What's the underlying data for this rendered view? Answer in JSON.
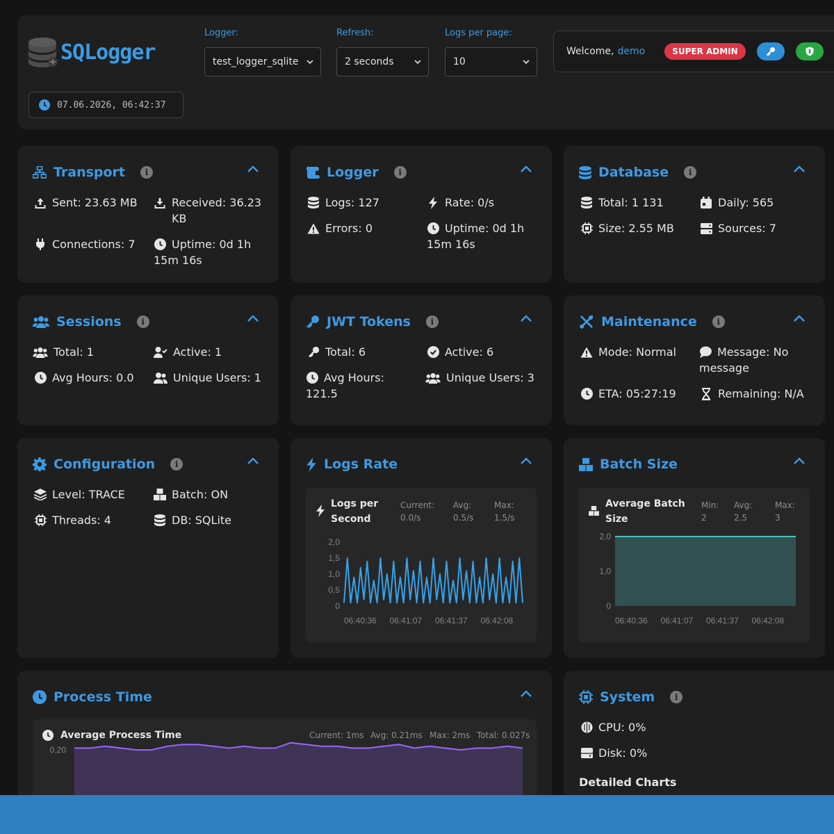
{
  "app": {
    "title": "SQLogger",
    "datetime": "07.06.2026, 06:42:37"
  },
  "controls": {
    "logger": {
      "label": "Logger:",
      "value": "test_logger_sqlite"
    },
    "refresh": {
      "label": "Refresh:",
      "value": "2 seconds"
    },
    "per_page": {
      "label": "Logs per page:",
      "value": "10"
    }
  },
  "user": {
    "welcome": "Welcome,",
    "name": "demo",
    "role": "SUPER ADMIN"
  },
  "cards": {
    "transport": {
      "title": "Transport",
      "sent": "Sent: 23.63 MB",
      "received": "Received: 36.23 KB",
      "connections": "Connections: 7",
      "uptime": "Uptime: 0d 1h 15m 16s"
    },
    "logger": {
      "title": "Logger",
      "logs": "Logs: 127",
      "rate": "Rate: 0/s",
      "errors": "Errors: 0",
      "uptime": "Uptime: 0d 1h 15m 16s"
    },
    "database": {
      "title": "Database",
      "total": "Total: 1 131",
      "daily": "Daily: 565",
      "size": "Size: 2.55 MB",
      "sources": "Sources: 7"
    },
    "sessions": {
      "title": "Sessions",
      "total": "Total: 1",
      "active": "Active: 1",
      "avg_hours": "Avg Hours: 0.0",
      "unique_users": "Unique Users: 1"
    },
    "jwt": {
      "title": "JWT Tokens",
      "total": "Total: 6",
      "active": "Active: 6",
      "avg_hours": "Avg Hours: 121.5",
      "unique_users": "Unique Users: 3"
    },
    "maintenance": {
      "title": "Maintenance",
      "mode": "Mode: Normal",
      "message": "Message: No message",
      "eta": "ETA: 05:27:19",
      "remaining": "Remaining: N/A"
    },
    "configuration": {
      "title": "Configuration",
      "level": "Level: TRACE",
      "batch": "Batch: ON",
      "threads": "Threads: 4",
      "db": "DB: SQLite"
    },
    "logs_rate": {
      "title": "Logs Rate",
      "panel_title": "Logs per Second",
      "current_label": "Current:",
      "current": "0.0/s",
      "avg_label": "Avg:",
      "avg": "0.5/s",
      "max_label": "Max:",
      "max": "1.5/s"
    },
    "batch_size": {
      "title": "Batch Size",
      "panel_title": "Average Batch Size",
      "min_label": "Min:",
      "min": "2",
      "avg_label": "Avg:",
      "avg": "2.5",
      "max_label": "Max:",
      "max": "3"
    },
    "process_time": {
      "title": "Process Time",
      "panel_title": "Average Process Time",
      "current": "Current: 1ms",
      "avg": "Avg: 0.21ms",
      "max": "Max: 2ms",
      "total": "Total: 0.027s"
    },
    "system": {
      "title": "System",
      "cpu": "CPU: 0%",
      "disk": "Disk: 0%",
      "detailed": "Detailed Charts"
    }
  },
  "chart_data": [
    {
      "type": "line",
      "title": "Logs per Second",
      "x_ticks": [
        "06:40:36",
        "06:41:07",
        "06:41:37",
        "06:42:08"
      ],
      "y_ticks": [
        "2,0",
        "1,5",
        "1,0",
        "0,5",
        "0"
      ],
      "ylim": [
        0,
        2.0
      ],
      "values": [
        0.1,
        1.5,
        0.1,
        0.9,
        0.1,
        1.2,
        0.2,
        1.4,
        0.1,
        0.8,
        0.1,
        1.5,
        0.2,
        1.0,
        0.1,
        1.4,
        0.1,
        0.9,
        0.1,
        1.5,
        0.2,
        1.1,
        0.1,
        1.4,
        0.1,
        0.9,
        0.1,
        1.5,
        0.2,
        1.0,
        0.1,
        1.4,
        0.1,
        0.8,
        0.1,
        1.5,
        0.2,
        1.1,
        0.1,
        1.4,
        0.1,
        0.9,
        0.1,
        1.5,
        0.2,
        1.0,
        0.1,
        1.5,
        0.1,
        0.9,
        0.1,
        1.4,
        0.1,
        1.5,
        0.1
      ],
      "color": "#36a2eb"
    },
    {
      "type": "area",
      "title": "Average Batch Size",
      "x_ticks": [
        "06:40:36",
        "06:41:07",
        "06:41:37",
        "06:42:08"
      ],
      "y_ticks": [
        "2,0",
        "1,0",
        "0"
      ],
      "ylim": [
        0,
        2.4
      ],
      "values": [
        2.0,
        2.0,
        2.0,
        2.0,
        2.0,
        2.0,
        2.0,
        2.0,
        2.0,
        2.0
      ],
      "color": "#4bc0c0"
    },
    {
      "type": "area",
      "title": "Average Process Time",
      "y_ticks": [
        "0,20"
      ],
      "values": [
        0.21,
        0.21,
        0.22,
        0.21,
        0.2,
        0.2,
        0.22,
        0.23,
        0.23,
        0.22,
        0.21,
        0.22,
        0.21,
        0.21,
        0.24,
        0.23,
        0.22,
        0.22,
        0.21,
        0.21,
        0.22,
        0.23,
        0.21,
        0.22,
        0.21,
        0.2,
        0.21,
        0.21,
        0.22,
        0.21
      ],
      "color": "#9966ff"
    }
  ],
  "colors": {
    "accent": "#3d9ae3",
    "danger": "#dc3545",
    "success": "#28a745",
    "card": "#1f1f1f",
    "bg": "#141414"
  }
}
